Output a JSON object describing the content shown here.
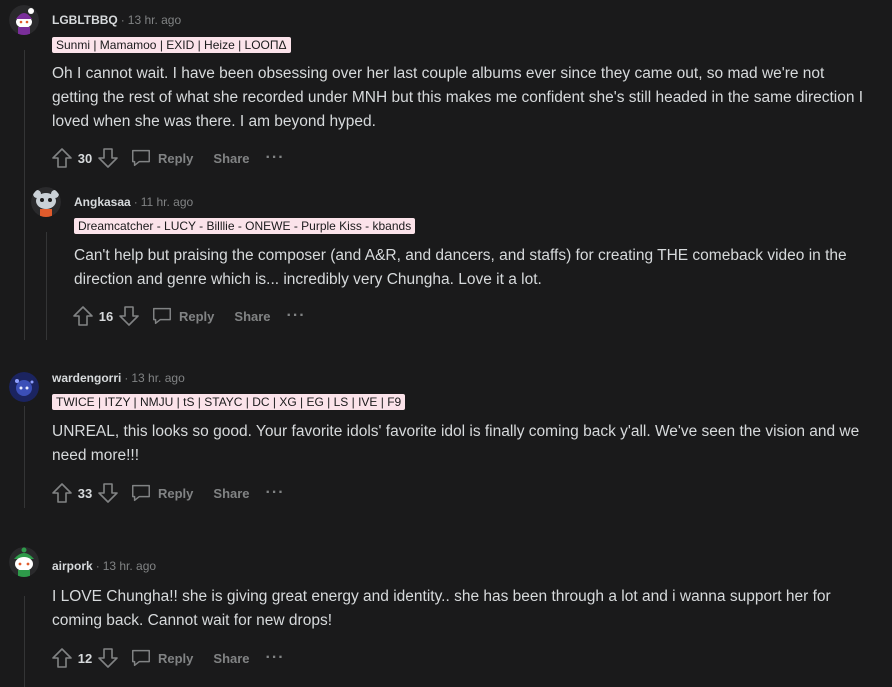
{
  "comments": [
    {
      "username": "LGBLTBBQ",
      "time": "13 hr. ago",
      "flair": "Sunmi | Mamamoo | EXID | Heize | LOOΠΔ",
      "body": "Oh I cannot wait. I have been obsessing over her last couple albums ever since they came out, so mad we're not getting the rest of what she recorded under MNH but this makes me confident she's still headed in the same direction I loved when she was there. I am beyond hyped.",
      "score": "30",
      "reply_label": "Reply",
      "share_label": "Share",
      "more_label": "···"
    },
    {
      "username": "Angkasaa",
      "time": "11 hr. ago",
      "flair": "Dreamcatcher - LUCY - Billlie - ONEWE - Purple Kiss - kbands",
      "body": "Can't help but praising the composer (and A&R, and dancers, and staffs) for creating THE comeback video in the direction and genre which is... incredibly very Chungha. Love it a lot.",
      "score": "16",
      "reply_label": "Reply",
      "share_label": "Share",
      "more_label": "···"
    },
    {
      "username": "wardengorri",
      "time": "13 hr. ago",
      "flair": "TWICE | ITZY | NMJU | tS | STAYC | DC | XG | EG | LS | IVE | F9",
      "body": "UNREAL, this looks so good. Your favorite idols' favorite idol is finally coming back y'all. We've seen the vision and we need more!!!",
      "score": "33",
      "reply_label": "Reply",
      "share_label": "Share",
      "more_label": "···"
    },
    {
      "username": "airpork",
      "time": "13 hr. ago",
      "flair": "",
      "body": "I LOVE Chungha!! she is giving great energy and identity.. she has been through a lot and i wanna support her for coming back. Cannot wait for new drops!",
      "score": "12",
      "reply_label": "Reply",
      "share_label": "Share",
      "more_label": "···"
    }
  ],
  "separator": "·",
  "icons": {
    "upvote": "upvote-icon",
    "downvote": "downvote-icon",
    "reply": "comment-bubble-icon",
    "avatar": "snoo-avatar"
  },
  "colors": {
    "background": "#1a1a1b",
    "text": "#d7dadc",
    "muted": "#818384",
    "flair_bg": "#fbe3ea"
  }
}
